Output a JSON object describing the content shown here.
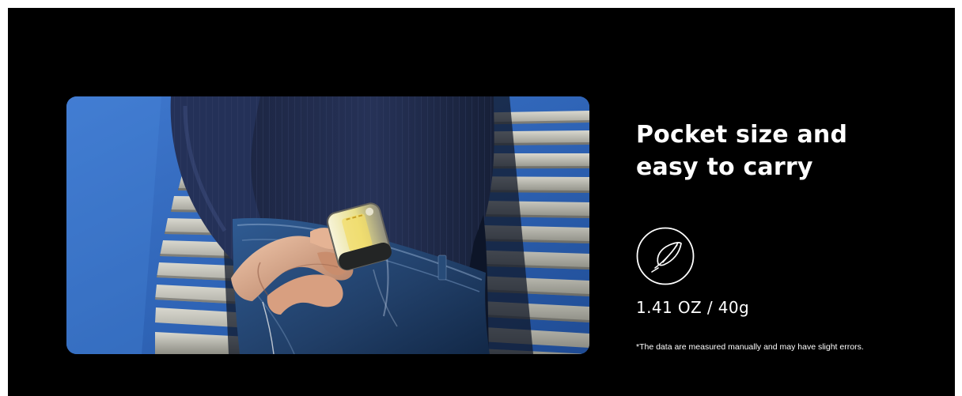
{
  "feature": {
    "headline_line1": "Pocket size and",
    "headline_line2": "easy to carry",
    "weight_value": "1.41 OZ / 40g",
    "footnote": "*The data are measured manually and may have slight errors.",
    "icon": "feather-icon"
  },
  "colors": {
    "background": "#000000",
    "text": "#ffffff",
    "sky": "#2f64b8",
    "denim": "#213f68",
    "sweater": "#1f2745"
  }
}
